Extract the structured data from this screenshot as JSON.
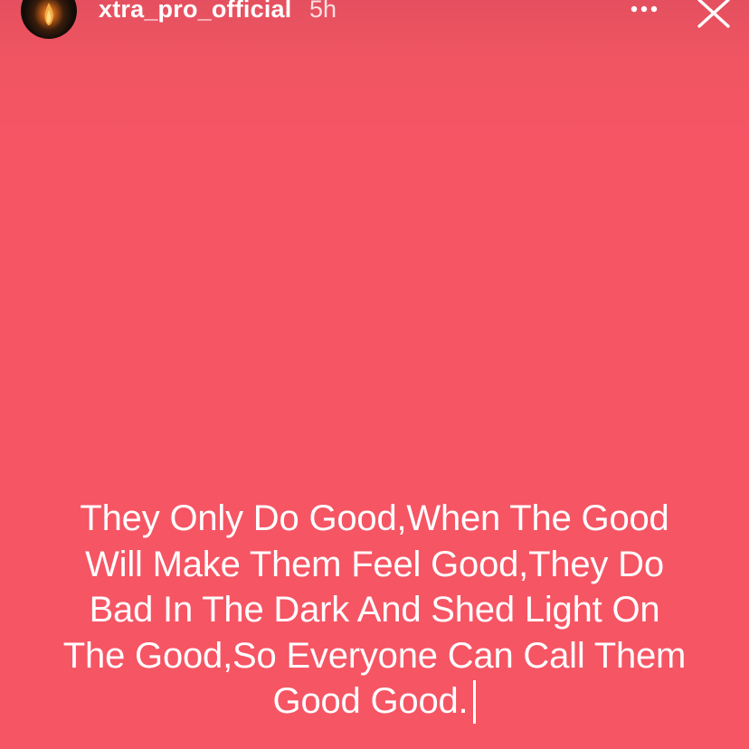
{
  "header": {
    "username": "xtra_pro_official",
    "time": "5h",
    "avatar_icon": "profile-avatar",
    "more_icon": "ellipsis-horizontal-icon",
    "close_icon": "close-icon"
  },
  "caption": {
    "lines": [
      "They Only Do Good,When The Good",
      "Will Make Them Feel Good,They Do",
      "Bad In The Dark And Shed Light On",
      "The Good,So Everyone Can Call Them",
      "Good Good."
    ]
  },
  "colors": {
    "background": "#f65564",
    "text": "#ffffff"
  }
}
